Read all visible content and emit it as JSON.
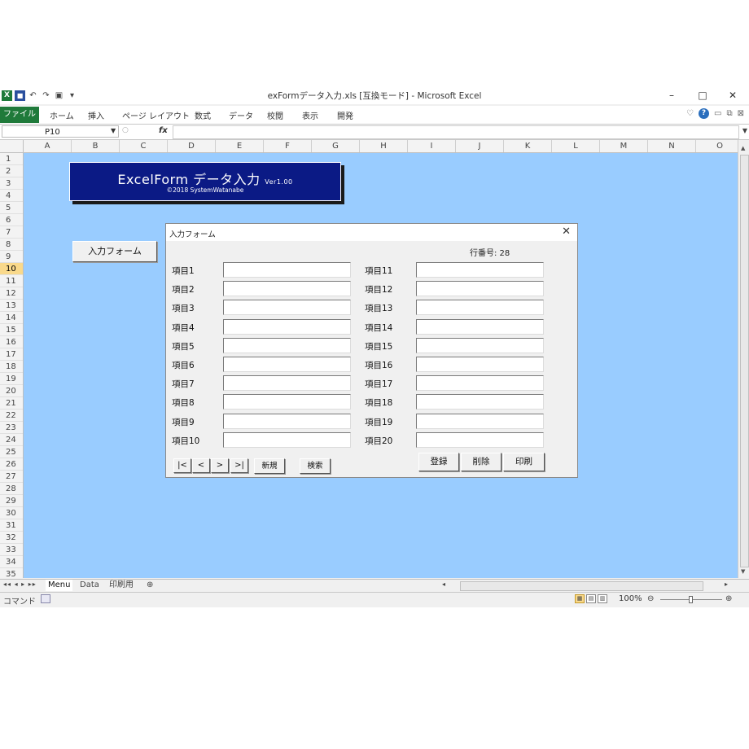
{
  "window": {
    "title": "exFormデータ入力.xls  [互換モード] - Microsoft Excel",
    "qat_icons": [
      "excel-icon",
      "save-icon",
      "undo-icon",
      "redo-icon",
      "print-preview-icon",
      "customize-icon"
    ],
    "controls": {
      "minimize": "–",
      "maximize": "□",
      "close": "✕"
    }
  },
  "ribbon": {
    "file_tab": "ファイル",
    "tabs": [
      "ホーム",
      "挿入",
      "ページ レイアウト",
      "数式",
      "データ",
      "校閲",
      "表示",
      "開発"
    ]
  },
  "formula_bar": {
    "name_box": "P10",
    "fx": "fx",
    "formula": ""
  },
  "sheet": {
    "columns": [
      "A",
      "B",
      "C",
      "D",
      "E",
      "F",
      "G",
      "H",
      "I",
      "J",
      "K",
      "L",
      "M",
      "N",
      "O"
    ],
    "rows": [
      "1",
      "2",
      "3",
      "4",
      "5",
      "6",
      "7",
      "8",
      "9",
      "10",
      "11",
      "12",
      "13",
      "14",
      "15",
      "16",
      "17",
      "18",
      "19",
      "20",
      "21",
      "22",
      "23",
      "24",
      "25",
      "26",
      "27",
      "28",
      "29",
      "30",
      "31",
      "32",
      "33",
      "34",
      "35"
    ],
    "selected_row": "10",
    "background_color": "#99ccff"
  },
  "banner": {
    "title": "ExcelForm データ入力",
    "version": "Ver1.00",
    "copyright": "©2018 SystemWatanabe",
    "bg_color": "#0b1a85"
  },
  "launch_button": {
    "label": "入力フォーム"
  },
  "dialog": {
    "title": "入力フォーム",
    "row_number_label": "行番号: 28",
    "fields_left": [
      "項目1",
      "項目2",
      "項目3",
      "項目4",
      "項目5",
      "項目6",
      "項目7",
      "項目8",
      "項目9",
      "項目10"
    ],
    "fields_right": [
      "項目11",
      "項目12",
      "項目13",
      "項目14",
      "項目15",
      "項目16",
      "項目17",
      "項目18",
      "項目19",
      "項目20"
    ],
    "nav_buttons": {
      "first": "|<",
      "prev": "<",
      "next": ">",
      "last": ">|"
    },
    "new_label": "新規",
    "search_label": "検索",
    "register_label": "登録",
    "delete_label": "削除",
    "print_label": "印刷"
  },
  "sheet_tabs": [
    "Menu",
    "Data",
    "印刷用"
  ],
  "status": {
    "mode": "コマンド",
    "zoom": "100%"
  }
}
